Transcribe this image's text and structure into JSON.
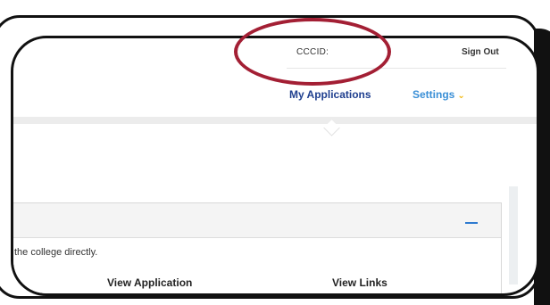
{
  "header": {
    "cccid_label": "CCCID:",
    "sign_out_label": "Sign Out"
  },
  "nav": {
    "my_applications": "My Applications",
    "settings": "Settings",
    "settings_chevron": "⌄"
  },
  "panel": {
    "message": "the college directly.",
    "columns": [
      "View Application",
      "View Links"
    ]
  },
  "colors": {
    "annotation": "#a31f34",
    "primary_nav": "#1f3f8f",
    "secondary_nav": "#3a8fd6",
    "accent": "#f2b400"
  },
  "icons": [
    "chevron-down-icon",
    "collapse-minus-icon"
  ]
}
